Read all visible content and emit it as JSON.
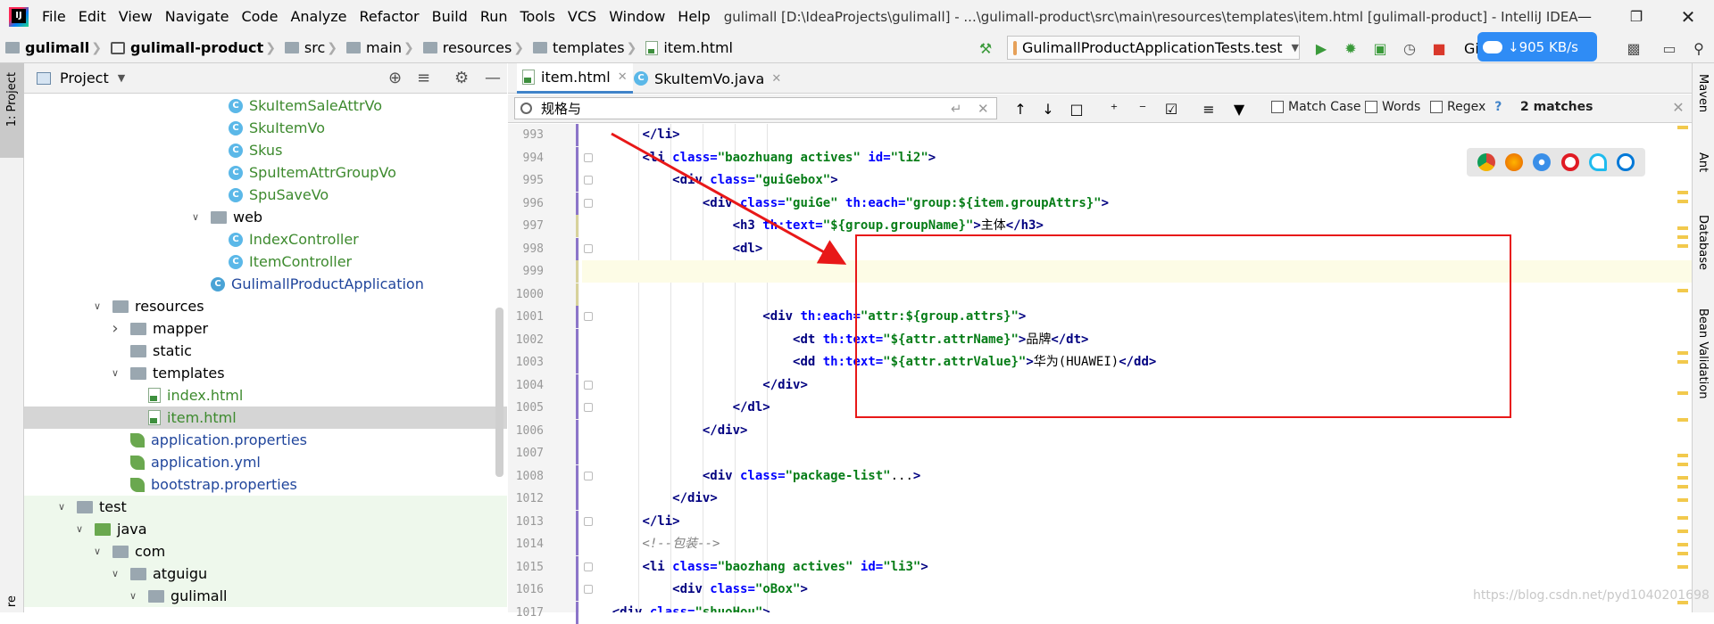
{
  "menu": {
    "items": [
      "File",
      "Edit",
      "View",
      "Navigate",
      "Code",
      "Analyze",
      "Refactor",
      "Build",
      "Run",
      "Tools",
      "VCS",
      "Window",
      "Help"
    ],
    "window_title": "gulimall [D:\\IdeaProjects\\gulimall] - ...\\gulimall-product\\src\\main\\resources\\templates\\item.html [gulimall-product] - IntelliJ IDEA"
  },
  "breadcrumb": [
    "gulimall",
    "gulimall-product",
    "src",
    "main",
    "resources",
    "templates",
    "item.html"
  ],
  "toolbar": {
    "run_config": "GulimallProductApplicationTests.test",
    "git_label": "Gi",
    "net_speed": "905 KB/s"
  },
  "left_strip": {
    "project_tab": "1: Project",
    "bottom_tab": "re"
  },
  "right_strip": [
    "Maven",
    "Ant",
    "Database",
    "Bean Validation"
  ],
  "project_panel": {
    "title": "Project"
  },
  "tree": [
    {
      "label": "SkuItemSaleAttrVo",
      "type": "class"
    },
    {
      "label": "SkuItemVo",
      "type": "class"
    },
    {
      "label": "Skus",
      "type": "class"
    },
    {
      "label": "SpuItemAttrGroupVo",
      "type": "class"
    },
    {
      "label": "SpuSaveVo",
      "type": "class"
    },
    {
      "label": "web",
      "type": "folder"
    },
    {
      "label": "IndexController",
      "type": "class"
    },
    {
      "label": "ItemController",
      "type": "class"
    },
    {
      "label": "GulimallProductApplication",
      "type": "app"
    },
    {
      "label": "resources",
      "type": "folder"
    },
    {
      "label": "mapper",
      "type": "folder"
    },
    {
      "label": "static",
      "type": "folder"
    },
    {
      "label": "templates",
      "type": "folder"
    },
    {
      "label": "index.html",
      "type": "html"
    },
    {
      "label": "item.html",
      "type": "html"
    },
    {
      "label": "application.properties",
      "type": "props"
    },
    {
      "label": "application.yml",
      "type": "props"
    },
    {
      "label": "bootstrap.properties",
      "type": "props"
    },
    {
      "label": "test",
      "type": "folder"
    },
    {
      "label": "java",
      "type": "folder"
    },
    {
      "label": "com",
      "type": "folder"
    },
    {
      "label": "atguigu",
      "type": "folder"
    },
    {
      "label": "gulimall",
      "type": "folder"
    }
  ],
  "editor_tabs": [
    "item.html",
    "SkuItemVo.java"
  ],
  "find": {
    "query": "规格与",
    "match_case": "Match Case",
    "words": "Words",
    "regex": "Regex",
    "help": "?",
    "matches": "2 matches"
  },
  "line_numbers": [
    "993",
    "994",
    "995",
    "996",
    "997",
    "998",
    "999",
    "1000",
    "1001",
    "1002",
    "1003",
    "1004",
    "1005",
    "1006",
    "1007",
    "1008",
    "1012",
    "1013",
    "1014",
    "1015",
    "1016",
    "1017"
  ],
  "code_lines": [
    "        </li>",
    "        <li class=\"baozhuang actives\" id=\"li2\">",
    "            <div class=\"guiGebox\">",
    "                <div class=\"guiGe\" th:each=\"group:${item.groupAttrs}\">",
    "                    <h3 th:text=\"${group.groupName}\">主体</h3>",
    "                    <dl>",
    "",
    "",
    "                        <div th:each=\"attr:${group.attrs}\">",
    "                            <dt th:text=\"${attr.attrName}\">品牌</dt>",
    "                            <dd th:text=\"${attr.attrValue}\">华为(HUAWEI)</dd>",
    "                        </div>",
    "                    </dl>",
    "                </div>",
    "",
    "                <div class=\"package-list\"...>",
    "            </div>",
    "        </li>",
    "        <!--包装-->",
    "        <li class=\"baozhang actives\" id=\"li3\">",
    "            <div class=\"oBox\">",
    "    <div class=\"shuoHou\">"
  ],
  "watermark": "https://blog.csdn.net/pyd1040201698",
  "colors": {
    "tag": "#000080",
    "attr": "#0000ff",
    "string": "#067d17",
    "accent": "#4083c9",
    "highlight": "#e81818"
  }
}
